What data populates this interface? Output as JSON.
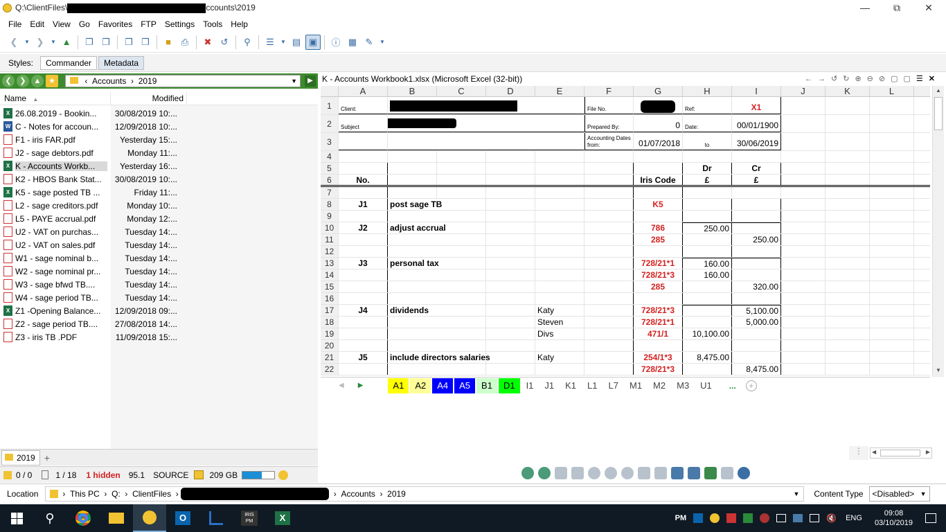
{
  "window": {
    "title_prefix": "Q:\\ClientFiles\\",
    "title_suffix": "ccounts\\2019"
  },
  "menu": [
    "File",
    "Edit",
    "View",
    "Go",
    "Favorites",
    "FTP",
    "Settings",
    "Tools",
    "Help"
  ],
  "styles": {
    "label": "Styles:",
    "tabs": [
      "Commander",
      "Metadata"
    ]
  },
  "nav": {
    "crumbs": [
      "Accounts",
      "2019"
    ]
  },
  "filelist": {
    "col_name": "Name",
    "col_modified": "Modified",
    "rows": [
      {
        "name": "26.08.2019 - Bookin...",
        "mod": "30/08/2019 10:...",
        "icon": "xls"
      },
      {
        "name": "C - Notes for accoun...",
        "mod": "12/09/2018 10:...",
        "icon": "doc"
      },
      {
        "name": "F1 - iris FAR.pdf",
        "mod": "Yesterday 15:...",
        "icon": "pdf"
      },
      {
        "name": "J2 - sage debtors.pdf",
        "mod": "Monday 11:...",
        "icon": "pdf"
      },
      {
        "name": "K - Accounts Workb...",
        "mod": "Yesterday 16:...",
        "icon": "xls",
        "selected": true
      },
      {
        "name": "K2 - HBOS Bank Stat...",
        "mod": "30/08/2019 10:...",
        "icon": "pdf"
      },
      {
        "name": "K5 - sage posted TB ...",
        "mod": "Friday 11:...",
        "icon": "xls"
      },
      {
        "name": "L2 - sage creditors.pdf",
        "mod": "Monday 10:...",
        "icon": "pdf"
      },
      {
        "name": "L5 - PAYE accrual.pdf",
        "mod": "Monday 12:...",
        "icon": "pdf"
      },
      {
        "name": "U2 - VAT on purchas...",
        "mod": "Tuesday 14:...",
        "icon": "pdf"
      },
      {
        "name": "U2 - VAT on sales.pdf",
        "mod": "Tuesday 14:...",
        "icon": "pdf"
      },
      {
        "name": "W1 - sage nominal b...",
        "mod": "Tuesday 14:...",
        "icon": "pdf"
      },
      {
        "name": "W2 - sage nominal pr...",
        "mod": "Tuesday 14:...",
        "icon": "pdf"
      },
      {
        "name": "W3 - sage bfwd TB....",
        "mod": "Tuesday 14:...",
        "icon": "pdf"
      },
      {
        "name": "W4 - sage period TB...",
        "mod": "Tuesday 14:...",
        "icon": "pdf"
      },
      {
        "name": "Z1 -Opening Balance...",
        "mod": "12/09/2018 09:...",
        "icon": "xls"
      },
      {
        "name": "Z2 - sage period TB....",
        "mod": "27/08/2018 14:...",
        "icon": "pdf"
      },
      {
        "name": "Z3 - iris TB .PDF",
        "mod": "11/09/2018 15:...",
        "icon": "pdf"
      }
    ]
  },
  "lefttab": {
    "label": "2019",
    "add": "+"
  },
  "status": {
    "sel1": "0 / 0",
    "sel2": "1 / 18",
    "hidden": "1 hidden",
    "num": "95.1",
    "source": "SOURCE",
    "space": "209 GB",
    "space_fill": 0.6
  },
  "preview": {
    "title": "K - Accounts Workbook1.xlsx (Microsoft Excel (32-bit))"
  },
  "sheet": {
    "cols": [
      "A",
      "B",
      "C",
      "D",
      "E",
      "F",
      "G",
      "H",
      "I",
      "J",
      "K",
      "L"
    ],
    "labels": {
      "client": "Client:",
      "file_no": "File No.",
      "ref": "Ref:",
      "ref_val": "X1",
      "subject": "Subject",
      "prepared": "Prepared By:",
      "prepared_val": "0",
      "date": "Date:",
      "date_val": "00/01/1900",
      "acc_dates": "Accounting Dates from:",
      "from": "01/07/2018",
      "to": "to",
      "to_val": "30/06/2019",
      "dr": "Dr",
      "cr": "Cr",
      "gbp1": "£",
      "gbp2": "£",
      "no": "No.",
      "iris": "Iris Code"
    },
    "journals": [
      {
        "row": "8",
        "no": "J1",
        "desc": "post sage TB",
        "e": "",
        "code": "K5",
        "dr": "",
        "cr": ""
      },
      {
        "row": "9",
        "no": "",
        "desc": "",
        "e": "",
        "code": "",
        "dr": "",
        "cr": ""
      },
      {
        "row": "10",
        "no": "J2",
        "desc": "adjust accrual",
        "e": "",
        "code": "786",
        "dr": "250.00",
        "cr": ""
      },
      {
        "row": "11",
        "no": "",
        "desc": "",
        "e": "",
        "code": "285",
        "dr": "",
        "cr": "250.00"
      },
      {
        "row": "12",
        "no": "",
        "desc": "",
        "e": "",
        "code": "",
        "dr": "",
        "cr": ""
      },
      {
        "row": "13",
        "no": "J3",
        "desc": "personal tax",
        "e": "",
        "code": "728/21*1",
        "dr": "160.00",
        "cr": ""
      },
      {
        "row": "14",
        "no": "",
        "desc": "",
        "e": "",
        "code": "728/21*3",
        "dr": "160.00",
        "cr": ""
      },
      {
        "row": "15",
        "no": "",
        "desc": "",
        "e": "",
        "code": "285",
        "dr": "",
        "cr": "320.00"
      },
      {
        "row": "16",
        "no": "",
        "desc": "",
        "e": "",
        "code": "",
        "dr": "",
        "cr": ""
      },
      {
        "row": "17",
        "no": "J4",
        "desc": "dividends",
        "e": "Katy",
        "code": "728/21*3",
        "dr": "",
        "cr": "5,100.00"
      },
      {
        "row": "18",
        "no": "",
        "desc": "",
        "e": "Steven",
        "code": "728/21*1",
        "dr": "",
        "cr": "5,000.00"
      },
      {
        "row": "19",
        "no": "",
        "desc": "",
        "e": "Divs",
        "code": "471/1",
        "dr": "10,100.00",
        "cr": ""
      },
      {
        "row": "20",
        "no": "",
        "desc": "",
        "e": "",
        "code": "",
        "dr": "",
        "cr": ""
      },
      {
        "row": "21",
        "no": "J5",
        "desc": "include directors salaries",
        "e": "Katy",
        "code": "254/1*3",
        "dr": "8,475.00",
        "cr": ""
      },
      {
        "row": "22",
        "no": "",
        "desc": "",
        "e": "",
        "code": "728/21*3",
        "dr": "",
        "cr": "8,475.00"
      }
    ],
    "tabs": [
      {
        "n": "A1",
        "bg": "#ffff00",
        "fg": "#000"
      },
      {
        "n": "A2",
        "bg": "#ffff99",
        "fg": "#000"
      },
      {
        "n": "A4",
        "bg": "#0000ff",
        "fg": "#fff"
      },
      {
        "n": "A5",
        "bg": "#0000ff",
        "fg": "#fff"
      },
      {
        "n": "B1",
        "bg": "#ccffcc",
        "fg": "#000"
      },
      {
        "n": "D1",
        "bg": "#00ff00",
        "fg": "#000"
      },
      {
        "n": "I1",
        "bg": "",
        "fg": "#444"
      },
      {
        "n": "J1",
        "bg": "",
        "fg": "#444"
      },
      {
        "n": "K1",
        "bg": "",
        "fg": "#444"
      },
      {
        "n": "L1",
        "bg": "",
        "fg": "#444"
      },
      {
        "n": "L7",
        "bg": "",
        "fg": "#444"
      },
      {
        "n": "M1",
        "bg": "",
        "fg": "#444"
      },
      {
        "n": "M2",
        "bg": "",
        "fg": "#444"
      },
      {
        "n": "M3",
        "bg": "",
        "fg": "#444"
      },
      {
        "n": "U1",
        "bg": "",
        "fg": "#444"
      }
    ],
    "more": "..."
  },
  "location": {
    "label": "Location",
    "crumbs": [
      "This PC",
      "Q:",
      "ClientFiles",
      "Accounts",
      "2019"
    ],
    "content_type": "Content Type",
    "disabled": "<Disabled>"
  },
  "tray": {
    "pm": "PM",
    "lang": "ENG",
    "time": "09:08",
    "date": "03/10/2019"
  },
  "iris_tk": "IRIS PM"
}
